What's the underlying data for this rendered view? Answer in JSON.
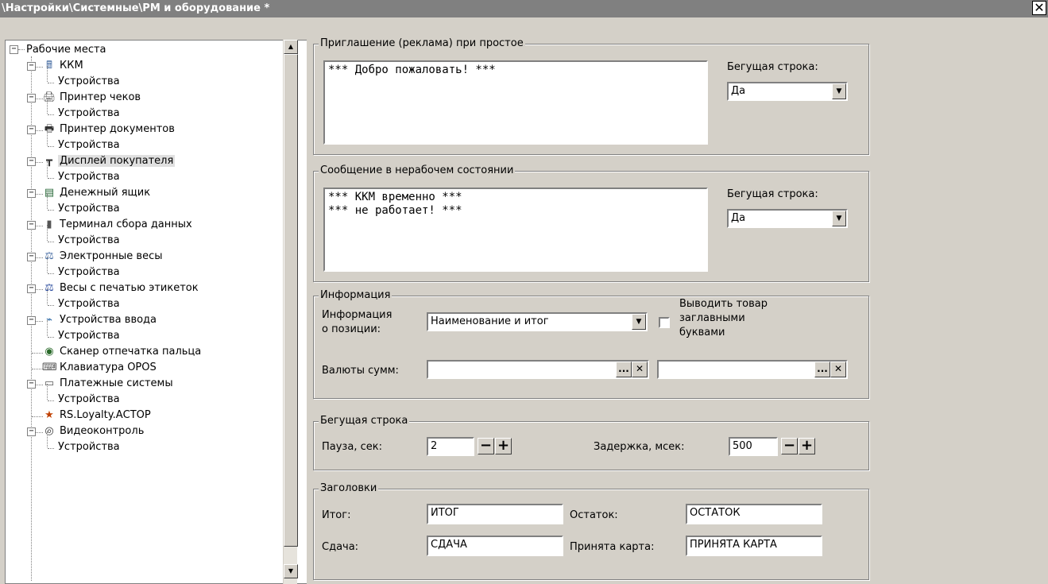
{
  "window": {
    "title": "\\Настройки\\Системные\\РМ и оборудование *",
    "close_label": "✕"
  },
  "tree": {
    "root": "Рабочие места",
    "items": [
      {
        "label": "ККМ",
        "icon": "cash-register-icon"
      },
      {
        "label": "Устройства"
      },
      {
        "label": "Принтер чеков",
        "icon": "receipt-printer-icon"
      },
      {
        "label": "Устройства"
      },
      {
        "label": "Принтер документов",
        "icon": "document-printer-icon"
      },
      {
        "label": "Устройства"
      },
      {
        "label": "Дисплей покупателя",
        "icon": "customer-display-icon"
      },
      {
        "label": "Устройства"
      },
      {
        "label": "Денежный ящик",
        "icon": "cash-drawer-icon"
      },
      {
        "label": "Устройства"
      },
      {
        "label": "Терминал сбора данных",
        "icon": "data-terminal-icon"
      },
      {
        "label": "Устройства"
      },
      {
        "label": "Электронные весы",
        "icon": "scale-icon"
      },
      {
        "label": "Устройства"
      },
      {
        "label": "Весы с печатью этикеток",
        "icon": "label-scale-icon"
      },
      {
        "label": "Устройства"
      },
      {
        "label": "Устройства ввода",
        "icon": "input-device-icon"
      },
      {
        "label": "Устройства"
      },
      {
        "label": "Сканер отпечатка пальца",
        "icon": "fingerprint-scanner-icon"
      },
      {
        "label": "Клавиатура OPOS",
        "icon": "keyboard-icon"
      },
      {
        "label": "Платежные системы",
        "icon": "payment-card-icon"
      },
      {
        "label": "Устройства"
      },
      {
        "label": "RS.Loyalty.АСТОР",
        "icon": "loyalty-icon"
      },
      {
        "label": "Видеоконтроль",
        "icon": "video-control-icon"
      },
      {
        "label": "Устройства"
      }
    ]
  },
  "invitation": {
    "legend": "Приглашение (реклама) при простое",
    "text": "*** Добро пожаловать! ***",
    "running_label": "Бегущая строка:",
    "running_value": "Да"
  },
  "offline_message": {
    "legend": "Сообщение в нерабочем состоянии",
    "text": "*** ККМ временно ***\n*** не работает! ***",
    "running_label": "Бегущая строка:",
    "running_value": "Да"
  },
  "info": {
    "legend": "Информация",
    "position_label_1": "Информация",
    "position_label_2": "о позиции:",
    "position_value": "Наименование и итог",
    "uppercase_label_1": "Выводить товар",
    "uppercase_label_2": "заглавными",
    "uppercase_label_3": "буквами",
    "currency_label": "Валюты сумм:",
    "currency_value_1": "",
    "currency_value_2": "",
    "ellipsis": "...",
    "clear": "✕"
  },
  "ticker": {
    "legend": "Бегущая строка",
    "pause_label": "Пауза, сек:",
    "pause_value": "2",
    "delay_label": "Задержка, мсек:",
    "delay_value": "500",
    "minus": "−",
    "plus": "+"
  },
  "headers": {
    "legend": "Заголовки",
    "total_label": "Итог:",
    "total_value": "ИТОГ",
    "rest_label": "Остаток:",
    "rest_value": "ОСТАТОК",
    "change_label": "Сдача:",
    "change_value": "СДАЧА",
    "card_label": "Принята карта:",
    "card_value": "ПРИНЯТА КАРТА"
  },
  "scroll": {
    "up": "▲",
    "down": "▼"
  },
  "combo_arrow": "▼",
  "tree_expander": "−"
}
